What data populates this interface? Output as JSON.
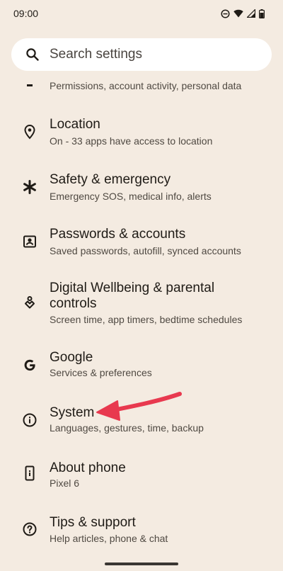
{
  "status_bar": {
    "time": "09:00",
    "icons": [
      "do-not-disturb-icon",
      "wifi-icon",
      "cell-signal-icon",
      "battery-icon"
    ]
  },
  "search": {
    "placeholder": "Search settings"
  },
  "settings_items": [
    {
      "title": "",
      "subtitle": "Permissions, account activity, personal data",
      "icon": "privacy-icon"
    },
    {
      "title": "Location",
      "subtitle": "On - 33 apps have access to location",
      "icon": "location-pin-icon"
    },
    {
      "title": "Safety & emergency",
      "subtitle": "Emergency SOS, medical info, alerts",
      "icon": "asterisk-icon"
    },
    {
      "title": "Passwords & accounts",
      "subtitle": "Saved passwords, autofill, synced accounts",
      "icon": "account-box-icon"
    },
    {
      "title_line1": "Digital Wellbeing & parental",
      "title_line2": "controls",
      "subtitle": "Screen time, app timers, bedtime schedules",
      "icon": "wellbeing-icon"
    },
    {
      "title": "Google",
      "subtitle": "Services & preferences",
      "icon": "google-g-icon"
    },
    {
      "title": "System",
      "subtitle": "Languages, gestures, time, backup",
      "icon": "info-icon"
    },
    {
      "title": "About phone",
      "subtitle": "Pixel 6",
      "icon": "phone-icon"
    },
    {
      "title": "Tips & support",
      "subtitle": "Help articles, phone & chat",
      "icon": "help-icon"
    }
  ],
  "colors": {
    "background": "#F4EBE1",
    "search_bg": "#FFFFFF",
    "text_primary": "#1F1B16",
    "text_secondary": "#4F4942",
    "annotation_arrow": "#E8394F"
  }
}
